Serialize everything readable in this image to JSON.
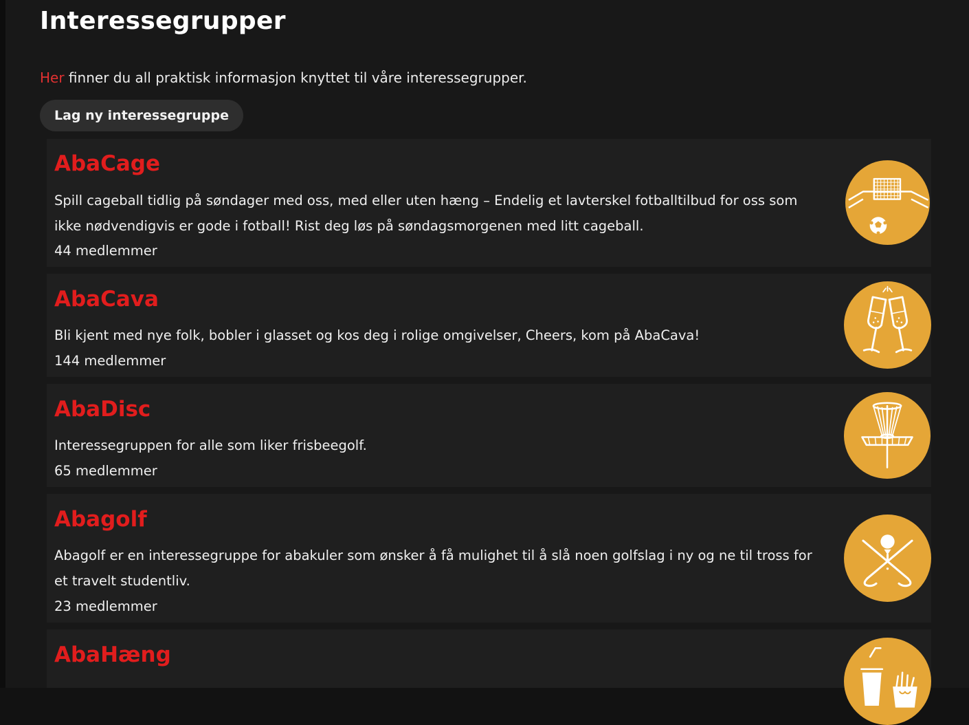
{
  "page": {
    "title": "Interessegrupper",
    "intro_link": "Her",
    "intro_rest": " finner du all praktisk informasjon knyttet til våre interessegrupper.",
    "new_button": "Lag ny interessegruppe"
  },
  "colors": {
    "accent_red": "#e11d1d",
    "icon_bg": "#e5a637",
    "card_bg": "#1f1f1f",
    "page_bg": "#181818"
  },
  "groups": [
    {
      "name": "AbaCage",
      "description": "Spill cageball tidlig på søndager med oss, med eller uten hæng – Endelig et lavterskel fotballtilbud for oss som ikke nødvendigvis er gode i fotball! Rist deg løs på søndagsmorgenen med litt cageball.",
      "members": "44 medlemmer",
      "icon": "soccer-goal-icon"
    },
    {
      "name": "AbaCava",
      "description": "Bli kjent med nye folk, bobler i glasset og kos deg i rolige omgivelser, Cheers, kom på AbaCava!",
      "members": "144 medlemmer",
      "icon": "champagne-glasses-icon"
    },
    {
      "name": "AbaDisc",
      "description": "Interessegruppen for alle som liker frisbeegolf.",
      "members": "65 medlemmer",
      "icon": "disc-golf-basket-icon"
    },
    {
      "name": "Abagolf",
      "description": "Abagolf er en interessegruppe for abakuler som ønsker å få mulighet til å slå noen golfslag i ny og ne til tross for et travelt studentliv.",
      "members": "23 medlemmer",
      "icon": "golf-clubs-icon"
    },
    {
      "name": "AbaHæng",
      "description": "",
      "members": "",
      "icon": "snacks-icon"
    }
  ]
}
